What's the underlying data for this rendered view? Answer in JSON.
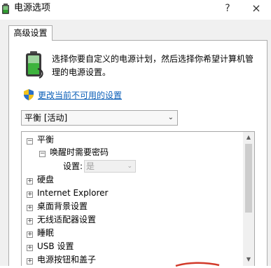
{
  "window": {
    "title": "电源选项",
    "help_label": "?",
    "close_label": "×"
  },
  "tabs": [
    {
      "label": "高级设置"
    }
  ],
  "description": "选择你要自定义的电源计划，然后选择你希望计算机管理的电源设置。",
  "change_link": "更改当前不可用的设置",
  "plan_select": {
    "value": "平衡 [活动]"
  },
  "tree": {
    "items": [
      {
        "label": "平衡",
        "expander": "⊟"
      },
      {
        "label": "唤醒时需要密码",
        "expander": "⊟"
      },
      {
        "label": "设置:",
        "value": "是"
      },
      {
        "label": "硬盘",
        "expander": "⊞"
      },
      {
        "label": "Internet Explorer",
        "expander": "⊞"
      },
      {
        "label": "桌面背景设置",
        "expander": "⊞"
      },
      {
        "label": "无线适配器设置",
        "expander": "⊞"
      },
      {
        "label": "睡眠",
        "expander": "⊞"
      },
      {
        "label": "USB 设置",
        "expander": "⊞"
      },
      {
        "label": "电源按钮和盖子",
        "expander": "⊞"
      }
    ]
  },
  "icons": {
    "title": "power-options-icon",
    "battery": "battery-icon",
    "shield": "shield-icon"
  },
  "colors": {
    "link": "#0b5fb8",
    "battery_green": "#3db33d"
  }
}
